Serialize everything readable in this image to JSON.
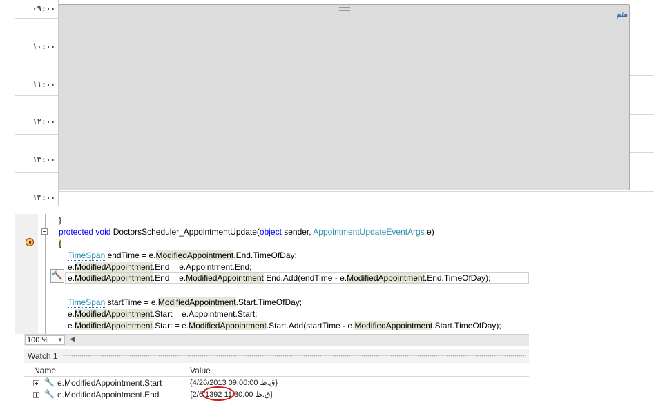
{
  "scheduler": {
    "time_slots": [
      "۰۹:۰۰",
      "۱۰:۰۰",
      "۱۱:۰۰",
      "۱۲:۰۰",
      "۱۳:۰۰",
      "۱۴:۰۰"
    ],
    "appointment_title": "متم"
  },
  "code": {
    "line1": "}",
    "line2_kw1": "protected",
    "line2_kw2": "void",
    "line2_method": "DoctorsScheduler_AppointmentUpdate",
    "line2_open": "(",
    "line2_kw3": "object",
    "line2_sender": " sender, ",
    "line2_type": "AppointmentUpdateEventArgs",
    "line2_end": " e)",
    "line3": "{",
    "line4_type": "TimeSpan",
    "line4_a": " endTime = e.",
    "line4_hl": "ModifiedAppointment",
    "line4_b": ".End.TimeOfDay;",
    "line5_a": "e.",
    "line5_hl": "ModifiedAppointment",
    "line5_b": ".End = e.Appointment.End;",
    "line6_a": "e.",
    "line6_hl1": "ModifiedAppointment",
    "line6_b": ".End = e.",
    "line6_hl2": "ModifiedAppointment",
    "line6_c": ".End.Add(endTime - e.",
    "line6_hl3": "ModifiedAppointment",
    "line6_d": ".End.TimeOfDay);",
    "line8_type": "TimeSpan",
    "line8_a": " startTime = e.",
    "line8_hl": "ModifiedAppointment",
    "line8_b": ".Start.TimeOfDay;",
    "line9_a": "e.",
    "line9_hl": "ModifiedAppointment",
    "line9_b": ".Start = e.Appointment.Start;",
    "line10_a": "e.",
    "line10_hl1": "ModifiedAppointment",
    "line10_b": ".Start = e.",
    "line10_hl2": "ModifiedAppointment",
    "line10_c": ".Start.Add(startTime - e.",
    "line10_hl3": "ModifiedAppointment",
    "line10_d": ".Start.TimeOfDay);"
  },
  "editor_footer": {
    "zoom": "100 %"
  },
  "watch": {
    "title": "Watch 1",
    "col_name": "Name",
    "col_value": "Value",
    "rows": [
      {
        "name": "e.ModifiedAppointment.Start",
        "value": "{4/26/2013 09:00:00 ق.ظ}"
      },
      {
        "name": "e.ModifiedAppointment.End",
        "value": "{2/6/1392 11:30:00 ق.ظ}"
      }
    ]
  },
  "icons": {
    "breakpoint": "breakpoint-icon",
    "hammer": "hammer-icon",
    "wrench": "wrench-icon",
    "expand": "expand-icon"
  }
}
